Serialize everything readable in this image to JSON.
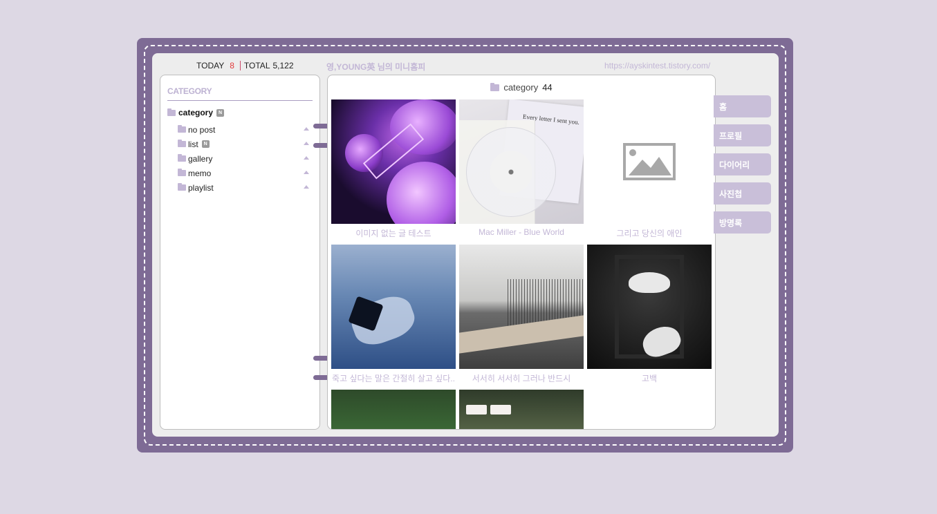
{
  "header": {
    "today_label": "TODAY",
    "today_count": "8",
    "total_label": "TOTAL",
    "total_count": "5,122",
    "blog_title": "영,YOUNG英 님의 미니홈피",
    "blog_url": "https://ayskintest.tistory.com/"
  },
  "sidebar": {
    "heading": "CATEGORY",
    "root": {
      "label": "category",
      "badge": "N"
    },
    "items": [
      {
        "label": "no post",
        "badge": ""
      },
      {
        "label": "list",
        "badge": "N"
      },
      {
        "label": "gallery",
        "badge": ""
      },
      {
        "label": "memo",
        "badge": ""
      },
      {
        "label": "playlist",
        "badge": ""
      }
    ]
  },
  "main": {
    "category_label": "category",
    "category_count": "44",
    "posts": [
      {
        "caption": "이미지 없는 글 테스트",
        "thumb": "space-planets-image"
      },
      {
        "caption": "Mac Miller - Blue World",
        "thumb": "vinyl-record-image"
      },
      {
        "caption": "그리고 당신의 애인",
        "thumb": "placeholder-image-icon"
      },
      {
        "caption": "죽고 싶다는 말은 간절히 살고 싶다..",
        "thumb": "underwater-image"
      },
      {
        "caption": "서서히 서서히 그러나 반드시",
        "thumb": "installation-room-image"
      },
      {
        "caption": "고백",
        "thumb": "doves-image"
      },
      {
        "caption": "",
        "thumb": "lake-image"
      },
      {
        "caption": "",
        "thumb": "pool-image"
      }
    ],
    "vinyl_text": "Every letter I sent you."
  },
  "menu": {
    "items": [
      "홈",
      "프로필",
      "다이어리",
      "사진첩",
      "방명록"
    ]
  },
  "colors": {
    "page_bg": "#ddd8e4",
    "frame": "#7e6b95",
    "accent_light": "#c3b7d6",
    "menu_bg": "#c9bfd9",
    "today_red": "#e23a3a"
  }
}
